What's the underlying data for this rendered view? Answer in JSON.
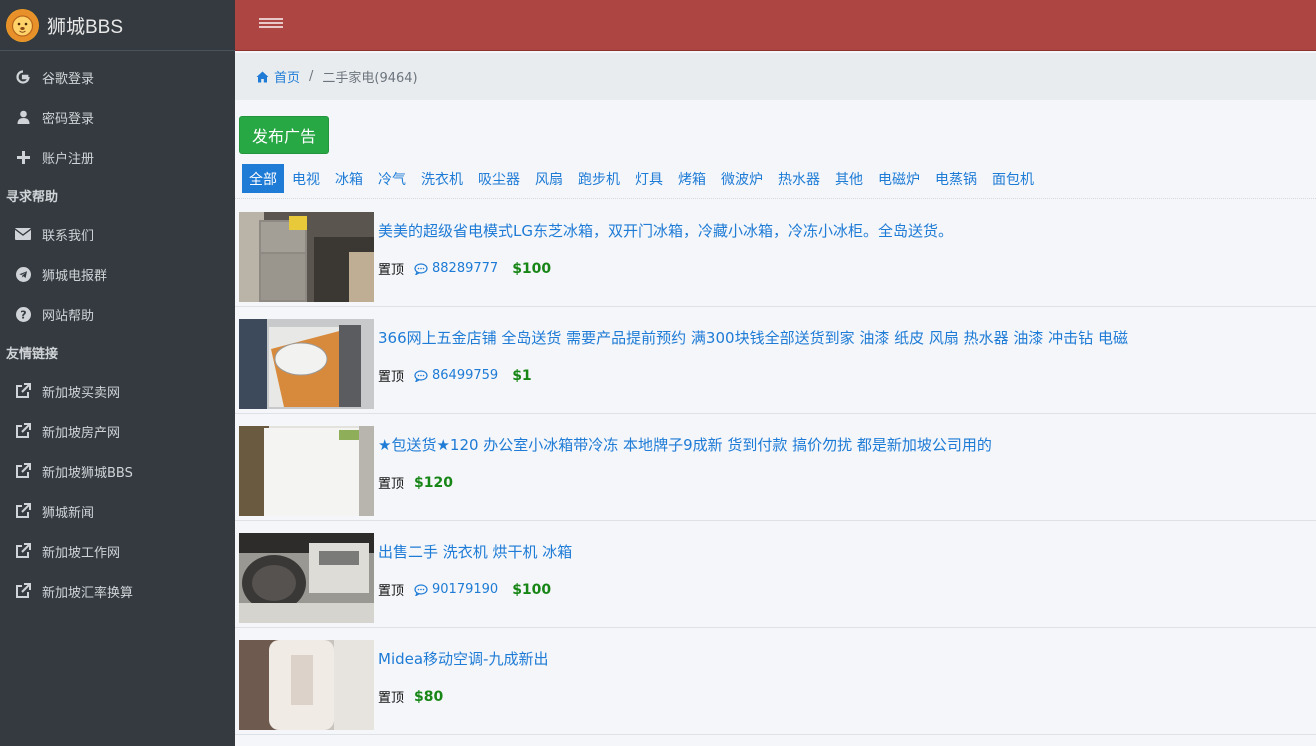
{
  "brand": {
    "name": "狮城BBS"
  },
  "sidebar": {
    "items": [
      {
        "label": "谷歌登录",
        "icon": "google-icon"
      },
      {
        "label": "密码登录",
        "icon": "user-icon"
      },
      {
        "label": "账户注册",
        "icon": "plus-icon"
      }
    ],
    "help_header": "寻求帮助",
    "help_items": [
      {
        "label": "联系我们",
        "icon": "envelope-icon"
      },
      {
        "label": "狮城电报群",
        "icon": "telegram-icon"
      },
      {
        "label": "网站帮助",
        "icon": "question-circle-icon"
      }
    ],
    "links_header": "友情链接",
    "link_items": [
      {
        "label": "新加坡买卖网",
        "icon": "external-link-icon"
      },
      {
        "label": "新加坡房产网",
        "icon": "external-link-icon"
      },
      {
        "label": "新加坡狮城BBS",
        "icon": "external-link-icon"
      },
      {
        "label": "狮城新闻",
        "icon": "external-link-icon"
      },
      {
        "label": "新加坡工作网",
        "icon": "external-link-icon"
      },
      {
        "label": "新加坡汇率换算",
        "icon": "external-link-icon"
      }
    ]
  },
  "breadcrumb": {
    "home": "首页",
    "separator": "/",
    "current": "二手家电(9464)"
  },
  "post_button": "发布广告",
  "categories": [
    "全部",
    "电视",
    "冰箱",
    "冷气",
    "洗衣机",
    "吸尘器",
    "风扇",
    "跑步机",
    "灯具",
    "烤箱",
    "微波炉",
    "热水器",
    "其他",
    "电磁炉",
    "电蒸锅",
    "面包机"
  ],
  "active_category": "全部",
  "listings": [
    {
      "title": "美美的超级省电模式LG东芝冰箱，双开门冰箱，冷藏小冰箱，冷冻小冰柜。全岛送货。",
      "pinned": "置顶",
      "phone": "88289777",
      "price": "$100"
    },
    {
      "title": "366网上五金店铺 全岛送货 需要产品提前预约 满300块钱全部送货到家 油漆 纸皮 风扇 热水器 油漆 冲击钻 电磁",
      "pinned": "置顶",
      "phone": "86499759",
      "price": "$1"
    },
    {
      "title": "★包送货★120 办公室小冰箱带冷冻 本地牌子9成新 货到付款 搞价勿扰 都是新加坡公司用的",
      "pinned": "置顶",
      "phone": "",
      "price": "$120"
    },
    {
      "title": "出售二手 洗衣机 烘干机 冰箱",
      "pinned": "置顶",
      "phone": "90179190",
      "price": "$100"
    },
    {
      "title": "Midea移动空调-九成新出",
      "pinned": "置顶",
      "phone": "",
      "price": "$80"
    }
  ]
}
